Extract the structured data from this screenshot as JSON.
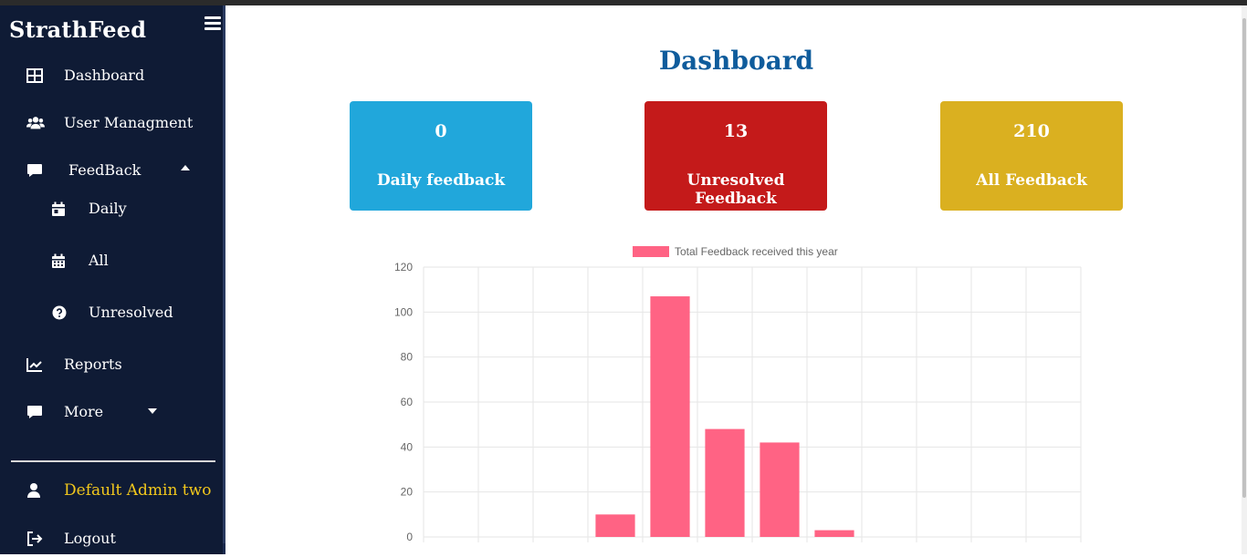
{
  "app": {
    "brand": "StrathFeed"
  },
  "sidebar": {
    "items": [
      {
        "label": "Dashboard",
        "icon": "dashboard-grid-icon"
      },
      {
        "label": "User Managment",
        "icon": "users-icon"
      },
      {
        "label": "FeedBack",
        "icon": "comment-icon",
        "expanded": true
      },
      {
        "label": "Daily",
        "icon": "calendar-day-icon"
      },
      {
        "label": "All",
        "icon": "calendar-icon"
      },
      {
        "label": "Unresolved",
        "icon": "question-circle-icon"
      },
      {
        "label": "Reports",
        "icon": "chart-line-icon"
      },
      {
        "label": "More",
        "icon": "comment-icon",
        "expanded": false
      }
    ],
    "user": {
      "label": "Default Admin two",
      "icon": "user-icon"
    },
    "logout": {
      "label": "Logout",
      "icon": "sign-out-icon"
    }
  },
  "main": {
    "title": "Dashboard",
    "cards": [
      {
        "value": "0",
        "caption": "Daily feedback",
        "color": "#21a7db"
      },
      {
        "value": "13",
        "caption": "Unresolved Feedback",
        "color": "#c41a1a"
      },
      {
        "value": "210",
        "caption": "All Feedback",
        "color": "#dab020"
      }
    ]
  },
  "chart_data": {
    "type": "bar",
    "legend": "Total Feedback received this year",
    "legend_position": "top",
    "bar_color": "#ff6384",
    "grid": true,
    "ylim": [
      0,
      120
    ],
    "yticks": [
      0,
      20,
      40,
      60,
      80,
      100,
      120
    ],
    "categories": [
      "",
      "",
      "",
      "",
      "",
      "",
      "",
      "",
      "",
      "",
      "",
      ""
    ],
    "values": [
      0,
      0,
      0,
      10,
      107,
      48,
      42,
      3,
      0,
      0,
      0,
      0
    ]
  }
}
